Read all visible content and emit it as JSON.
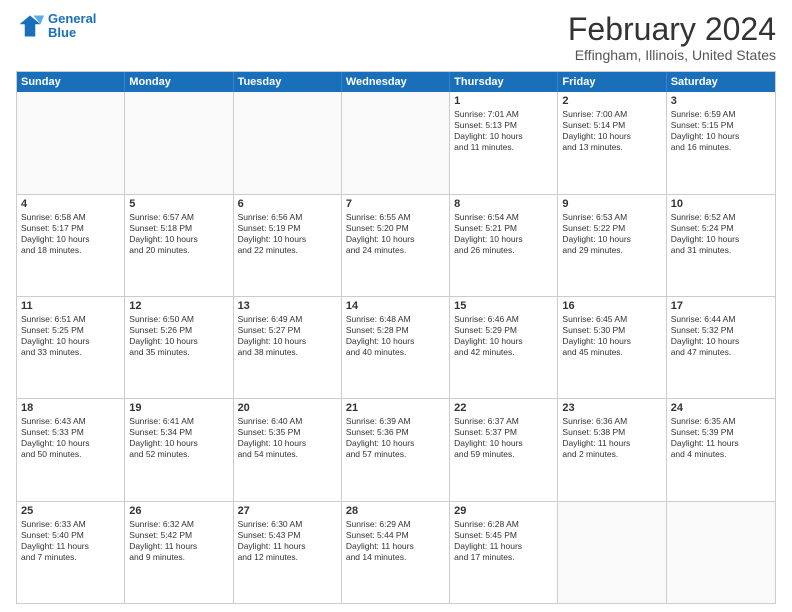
{
  "logo": {
    "line1": "General",
    "line2": "Blue"
  },
  "title": "February 2024",
  "subtitle": "Effingham, Illinois, United States",
  "weekdays": [
    "Sunday",
    "Monday",
    "Tuesday",
    "Wednesday",
    "Thursday",
    "Friday",
    "Saturday"
  ],
  "rows": [
    [
      {
        "day": "",
        "lines": []
      },
      {
        "day": "",
        "lines": []
      },
      {
        "day": "",
        "lines": []
      },
      {
        "day": "",
        "lines": []
      },
      {
        "day": "1",
        "lines": [
          "Sunrise: 7:01 AM",
          "Sunset: 5:13 PM",
          "Daylight: 10 hours",
          "and 11 minutes."
        ]
      },
      {
        "day": "2",
        "lines": [
          "Sunrise: 7:00 AM",
          "Sunset: 5:14 PM",
          "Daylight: 10 hours",
          "and 13 minutes."
        ]
      },
      {
        "day": "3",
        "lines": [
          "Sunrise: 6:59 AM",
          "Sunset: 5:15 PM",
          "Daylight: 10 hours",
          "and 16 minutes."
        ]
      }
    ],
    [
      {
        "day": "4",
        "lines": [
          "Sunrise: 6:58 AM",
          "Sunset: 5:17 PM",
          "Daylight: 10 hours",
          "and 18 minutes."
        ]
      },
      {
        "day": "5",
        "lines": [
          "Sunrise: 6:57 AM",
          "Sunset: 5:18 PM",
          "Daylight: 10 hours",
          "and 20 minutes."
        ]
      },
      {
        "day": "6",
        "lines": [
          "Sunrise: 6:56 AM",
          "Sunset: 5:19 PM",
          "Daylight: 10 hours",
          "and 22 minutes."
        ]
      },
      {
        "day": "7",
        "lines": [
          "Sunrise: 6:55 AM",
          "Sunset: 5:20 PM",
          "Daylight: 10 hours",
          "and 24 minutes."
        ]
      },
      {
        "day": "8",
        "lines": [
          "Sunrise: 6:54 AM",
          "Sunset: 5:21 PM",
          "Daylight: 10 hours",
          "and 26 minutes."
        ]
      },
      {
        "day": "9",
        "lines": [
          "Sunrise: 6:53 AM",
          "Sunset: 5:22 PM",
          "Daylight: 10 hours",
          "and 29 minutes."
        ]
      },
      {
        "day": "10",
        "lines": [
          "Sunrise: 6:52 AM",
          "Sunset: 5:24 PM",
          "Daylight: 10 hours",
          "and 31 minutes."
        ]
      }
    ],
    [
      {
        "day": "11",
        "lines": [
          "Sunrise: 6:51 AM",
          "Sunset: 5:25 PM",
          "Daylight: 10 hours",
          "and 33 minutes."
        ]
      },
      {
        "day": "12",
        "lines": [
          "Sunrise: 6:50 AM",
          "Sunset: 5:26 PM",
          "Daylight: 10 hours",
          "and 35 minutes."
        ]
      },
      {
        "day": "13",
        "lines": [
          "Sunrise: 6:49 AM",
          "Sunset: 5:27 PM",
          "Daylight: 10 hours",
          "and 38 minutes."
        ]
      },
      {
        "day": "14",
        "lines": [
          "Sunrise: 6:48 AM",
          "Sunset: 5:28 PM",
          "Daylight: 10 hours",
          "and 40 minutes."
        ]
      },
      {
        "day": "15",
        "lines": [
          "Sunrise: 6:46 AM",
          "Sunset: 5:29 PM",
          "Daylight: 10 hours",
          "and 42 minutes."
        ]
      },
      {
        "day": "16",
        "lines": [
          "Sunrise: 6:45 AM",
          "Sunset: 5:30 PM",
          "Daylight: 10 hours",
          "and 45 minutes."
        ]
      },
      {
        "day": "17",
        "lines": [
          "Sunrise: 6:44 AM",
          "Sunset: 5:32 PM",
          "Daylight: 10 hours",
          "and 47 minutes."
        ]
      }
    ],
    [
      {
        "day": "18",
        "lines": [
          "Sunrise: 6:43 AM",
          "Sunset: 5:33 PM",
          "Daylight: 10 hours",
          "and 50 minutes."
        ]
      },
      {
        "day": "19",
        "lines": [
          "Sunrise: 6:41 AM",
          "Sunset: 5:34 PM",
          "Daylight: 10 hours",
          "and 52 minutes."
        ]
      },
      {
        "day": "20",
        "lines": [
          "Sunrise: 6:40 AM",
          "Sunset: 5:35 PM",
          "Daylight: 10 hours",
          "and 54 minutes."
        ]
      },
      {
        "day": "21",
        "lines": [
          "Sunrise: 6:39 AM",
          "Sunset: 5:36 PM",
          "Daylight: 10 hours",
          "and 57 minutes."
        ]
      },
      {
        "day": "22",
        "lines": [
          "Sunrise: 6:37 AM",
          "Sunset: 5:37 PM",
          "Daylight: 10 hours",
          "and 59 minutes."
        ]
      },
      {
        "day": "23",
        "lines": [
          "Sunrise: 6:36 AM",
          "Sunset: 5:38 PM",
          "Daylight: 11 hours",
          "and 2 minutes."
        ]
      },
      {
        "day": "24",
        "lines": [
          "Sunrise: 6:35 AM",
          "Sunset: 5:39 PM",
          "Daylight: 11 hours",
          "and 4 minutes."
        ]
      }
    ],
    [
      {
        "day": "25",
        "lines": [
          "Sunrise: 6:33 AM",
          "Sunset: 5:40 PM",
          "Daylight: 11 hours",
          "and 7 minutes."
        ]
      },
      {
        "day": "26",
        "lines": [
          "Sunrise: 6:32 AM",
          "Sunset: 5:42 PM",
          "Daylight: 11 hours",
          "and 9 minutes."
        ]
      },
      {
        "day": "27",
        "lines": [
          "Sunrise: 6:30 AM",
          "Sunset: 5:43 PM",
          "Daylight: 11 hours",
          "and 12 minutes."
        ]
      },
      {
        "day": "28",
        "lines": [
          "Sunrise: 6:29 AM",
          "Sunset: 5:44 PM",
          "Daylight: 11 hours",
          "and 14 minutes."
        ]
      },
      {
        "day": "29",
        "lines": [
          "Sunrise: 6:28 AM",
          "Sunset: 5:45 PM",
          "Daylight: 11 hours",
          "and 17 minutes."
        ]
      },
      {
        "day": "",
        "lines": []
      },
      {
        "day": "",
        "lines": []
      }
    ]
  ]
}
